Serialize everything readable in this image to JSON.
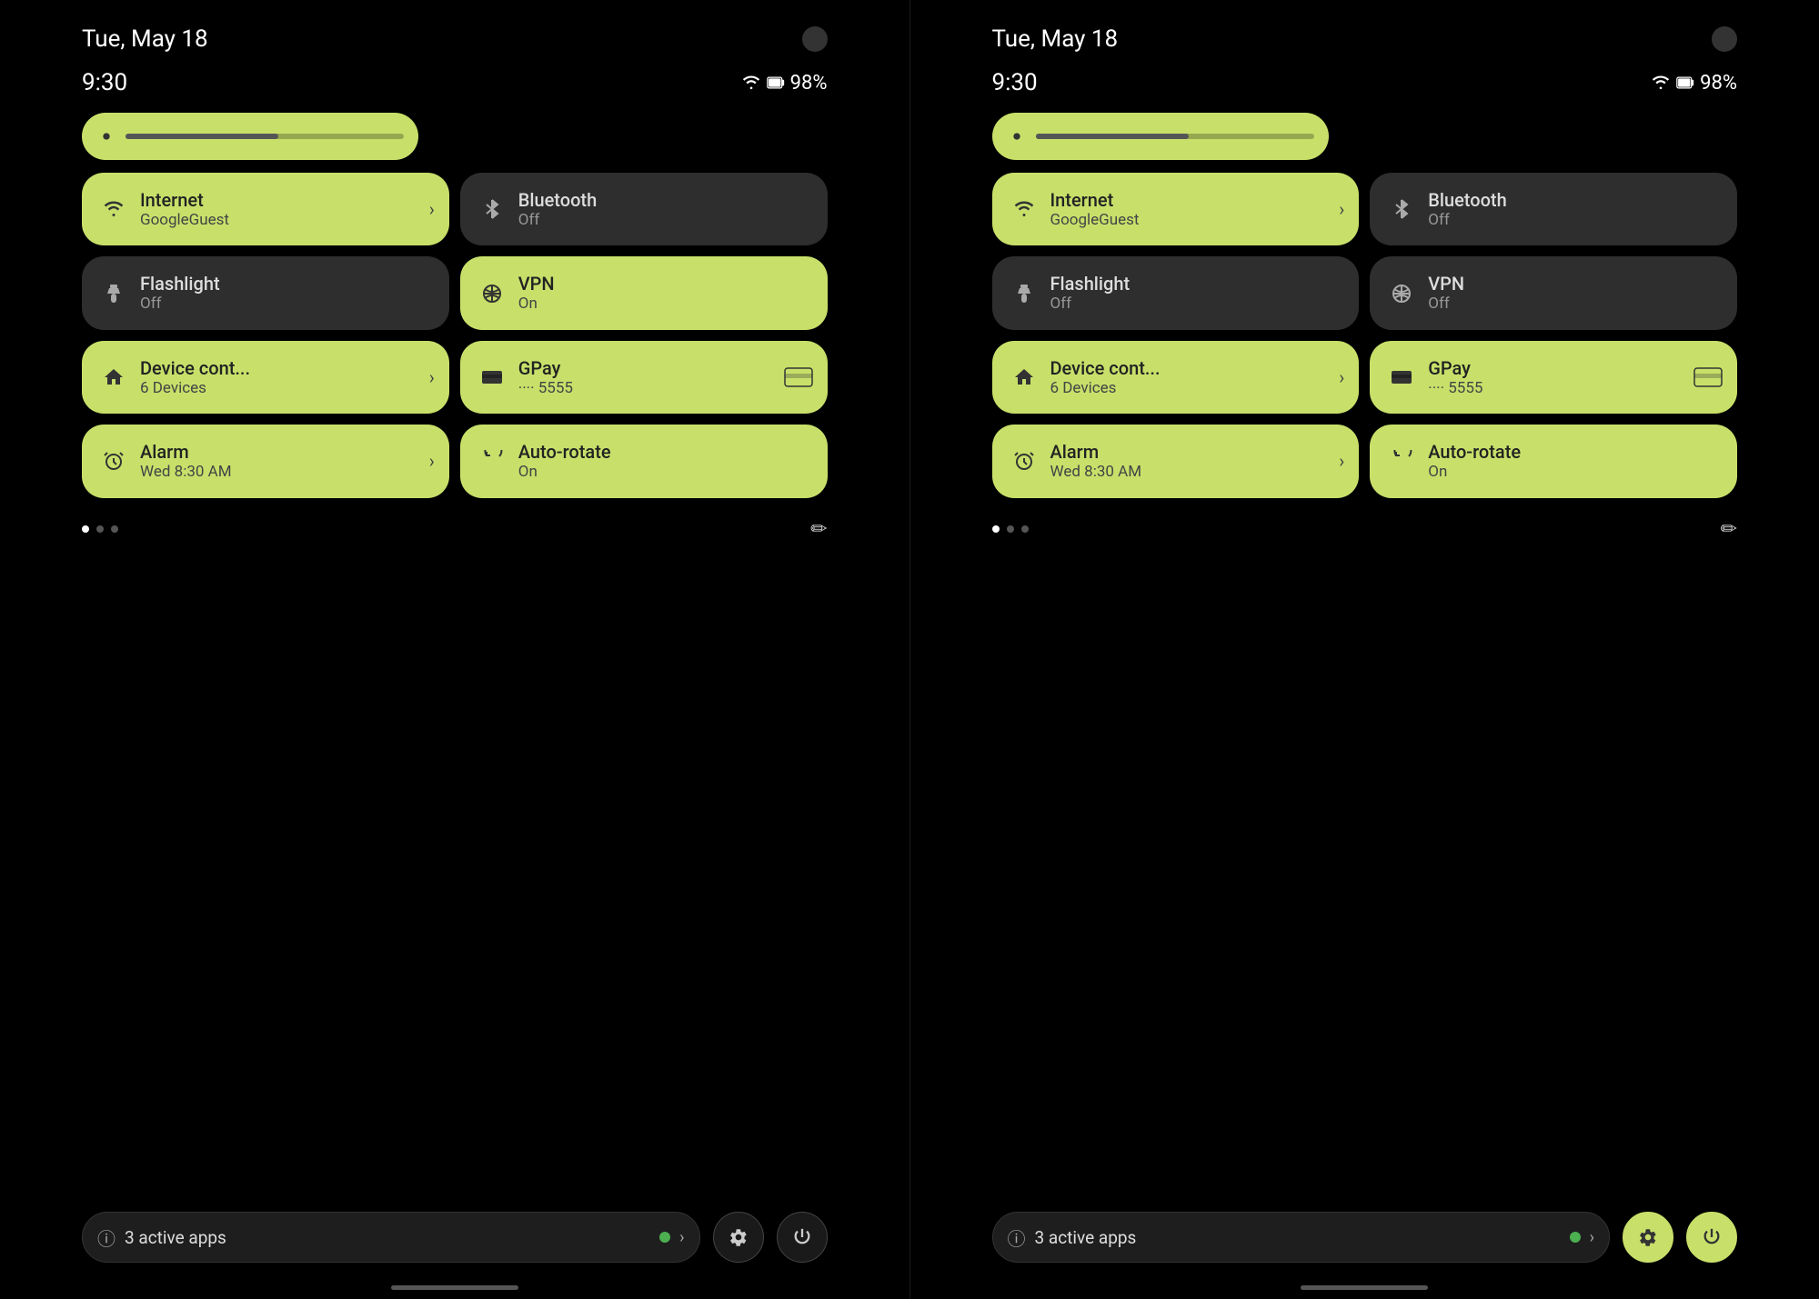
{
  "panels": [
    {
      "id": "left",
      "date": "Tue, May 18",
      "time": "9:30",
      "battery": "98%",
      "brightness": {
        "level": 55
      },
      "tiles": [
        {
          "id": "internet",
          "title": "Internet",
          "subtitle": "GoogleGuest",
          "state": "active",
          "icon": "wifi",
          "hasArrow": true
        },
        {
          "id": "bluetooth",
          "title": "Bluetooth",
          "subtitle": "Off",
          "state": "inactive",
          "icon": "bluetooth",
          "hasArrow": false
        },
        {
          "id": "flashlight",
          "title": "Flashlight",
          "subtitle": "Off",
          "state": "inactive",
          "icon": "flashlight",
          "hasArrow": false
        },
        {
          "id": "vpn",
          "title": "VPN",
          "subtitle": "On",
          "state": "active",
          "icon": "vpn",
          "hasArrow": false
        },
        {
          "id": "device",
          "title": "Device cont...",
          "subtitle": "6 Devices",
          "state": "active",
          "icon": "home",
          "hasArrow": true
        },
        {
          "id": "gpay",
          "title": "GPay",
          "subtitle": "···· 5555",
          "state": "active",
          "icon": "card",
          "hasArrow": false,
          "hasCardExtra": true
        },
        {
          "id": "alarm",
          "title": "Alarm",
          "subtitle": "Wed 8:30 AM",
          "state": "active",
          "icon": "alarm",
          "hasArrow": true
        },
        {
          "id": "autorotate",
          "title": "Auto-rotate",
          "subtitle": "On",
          "state": "active",
          "icon": "rotate",
          "hasArrow": false
        }
      ],
      "activeApps": "3 active apps",
      "settingsBtnActive": false,
      "powerBtnActive": false
    },
    {
      "id": "right",
      "date": "Tue, May 18",
      "time": "9:30",
      "battery": "98%",
      "brightness": {
        "level": 55
      },
      "tiles": [
        {
          "id": "internet",
          "title": "Internet",
          "subtitle": "GoogleGuest",
          "state": "active",
          "icon": "wifi",
          "hasArrow": true
        },
        {
          "id": "bluetooth",
          "title": "Bluetooth",
          "subtitle": "Off",
          "state": "inactive",
          "icon": "bluetooth",
          "hasArrow": false
        },
        {
          "id": "flashlight",
          "title": "Flashlight",
          "subtitle": "Off",
          "state": "inactive",
          "icon": "flashlight",
          "hasArrow": false
        },
        {
          "id": "vpn",
          "title": "VPN",
          "subtitle": "Off",
          "state": "inactive",
          "icon": "vpn",
          "hasArrow": false
        },
        {
          "id": "device",
          "title": "Device cont...",
          "subtitle": "6 Devices",
          "state": "active",
          "icon": "home",
          "hasArrow": true
        },
        {
          "id": "gpay",
          "title": "GPay",
          "subtitle": "···· 5555",
          "state": "active",
          "icon": "card",
          "hasArrow": false,
          "hasCardExtra": true
        },
        {
          "id": "alarm",
          "title": "Alarm",
          "subtitle": "Wed 8:30 AM",
          "state": "active",
          "icon": "alarm",
          "hasArrow": true
        },
        {
          "id": "autorotate",
          "title": "Auto-rotate",
          "subtitle": "On",
          "state": "active",
          "icon": "rotate",
          "hasArrow": false
        }
      ],
      "activeApps": "3 active apps",
      "settingsBtnActive": true,
      "powerBtnActive": true
    }
  ],
  "icons": {
    "wifi": "▲",
    "bluetooth": "*",
    "flashlight": "🔦",
    "vpn": "⊕",
    "home": "⌂",
    "card": "▬",
    "alarm": "⏰",
    "rotate": "↻",
    "settings": "⚙",
    "power": "⏻",
    "edit": "✏",
    "info": "ⓘ",
    "chevron": "›"
  }
}
